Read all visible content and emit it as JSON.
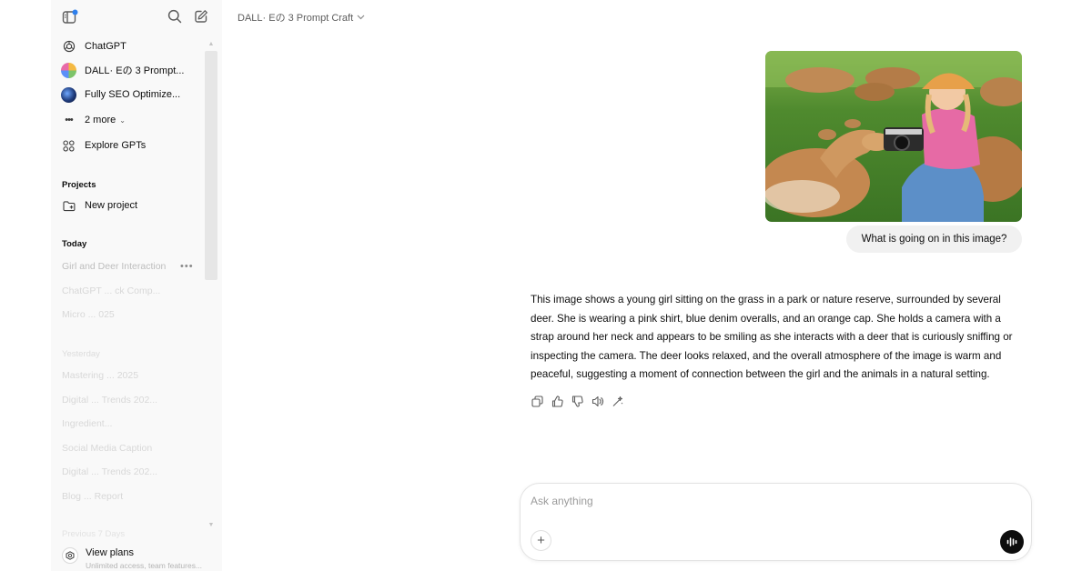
{
  "header": {
    "model_title": "DALL· Eの 3 Prompt Craft"
  },
  "sidebar": {
    "gpts": [
      {
        "label": "ChatGPT",
        "icon": "openai-logo-icon"
      },
      {
        "label": "DALL· Eの 3 Prompt...",
        "icon": "gpt-avatar"
      },
      {
        "label": "Fully SEO Optimize...",
        "icon": "gpt-avatar"
      },
      {
        "label": "2 more",
        "icon": "more-dots-icon"
      },
      {
        "label": "Explore GPTs",
        "icon": "grid-icon"
      }
    ],
    "projects_heading": "Projects",
    "new_project_label": "New project",
    "today_heading": "Today",
    "today_items": [
      "Girl and Deer Interaction",
      "ChatGPT ... ck Comp...",
      "Micro ... 025"
    ],
    "yesterday_heading": "Yesterday",
    "yesterday_items": [
      "Mastering ... 2025",
      "Digital ... Trends 202...",
      "Ingredient...",
      "Social Media Caption",
      "Digital ... Trends 202...",
      "Blog ... Report"
    ],
    "older_heading": "Previous 7 Days",
    "view_plans_title": "View plans",
    "view_plans_subtitle": "Unlimited access, team features..."
  },
  "chat": {
    "user_image_alt": "Girl with camera and deer",
    "user_message": "What is going on in this image?",
    "assistant_message": "This image shows a young girl sitting on the grass in a park or nature reserve, surrounded by several deer. She is wearing a pink shirt, blue denim overalls, and an orange cap. She holds a camera with a strap around her neck and appears to be smiling as she interacts with a deer that is curiously sniffing or inspecting the camera. The deer looks relaxed, and the overall atmosphere of the image is warm and peaceful, suggesting a moment of connection between the girl and the animals in a natural setting."
  },
  "composer": {
    "placeholder": "Ask anything",
    "value": ""
  },
  "colors": {
    "sidebar_bg": "#f9f9f9",
    "bubble_bg": "#f1f1f1",
    "voice_button": "#0d0d0d",
    "notification_dot": "#2f80ed"
  }
}
